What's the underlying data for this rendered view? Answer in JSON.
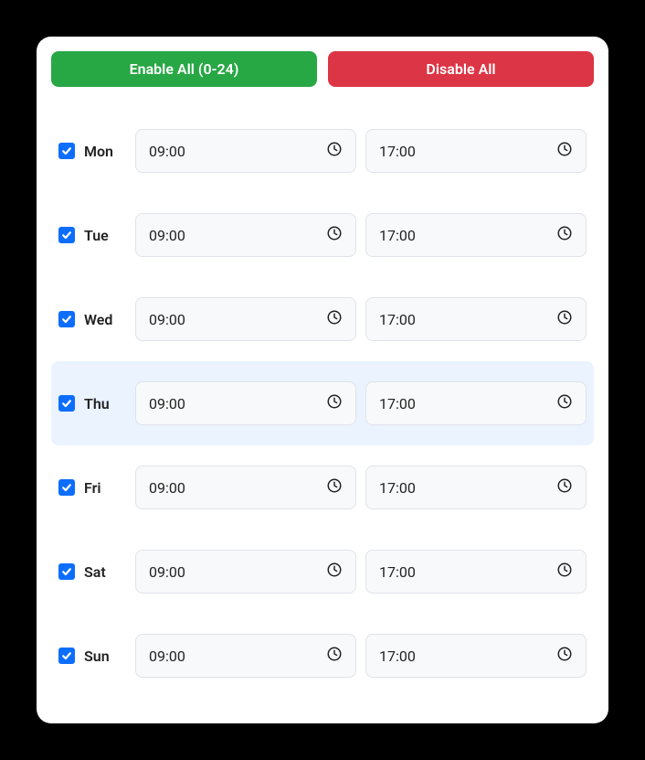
{
  "buttons": {
    "enable_all": "Enable All (0-24)",
    "disable_all": "Disable All"
  },
  "days": [
    {
      "label": "Mon",
      "checked": true,
      "start": "09:00",
      "end": "17:00",
      "highlight": false
    },
    {
      "label": "Tue",
      "checked": true,
      "start": "09:00",
      "end": "17:00",
      "highlight": false
    },
    {
      "label": "Wed",
      "checked": true,
      "start": "09:00",
      "end": "17:00",
      "highlight": false
    },
    {
      "label": "Thu",
      "checked": true,
      "start": "09:00",
      "end": "17:00",
      "highlight": true
    },
    {
      "label": "Fri",
      "checked": true,
      "start": "09:00",
      "end": "17:00",
      "highlight": false
    },
    {
      "label": "Sat",
      "checked": true,
      "start": "09:00",
      "end": "17:00",
      "highlight": false
    },
    {
      "label": "Sun",
      "checked": true,
      "start": "09:00",
      "end": "17:00",
      "highlight": false
    }
  ]
}
